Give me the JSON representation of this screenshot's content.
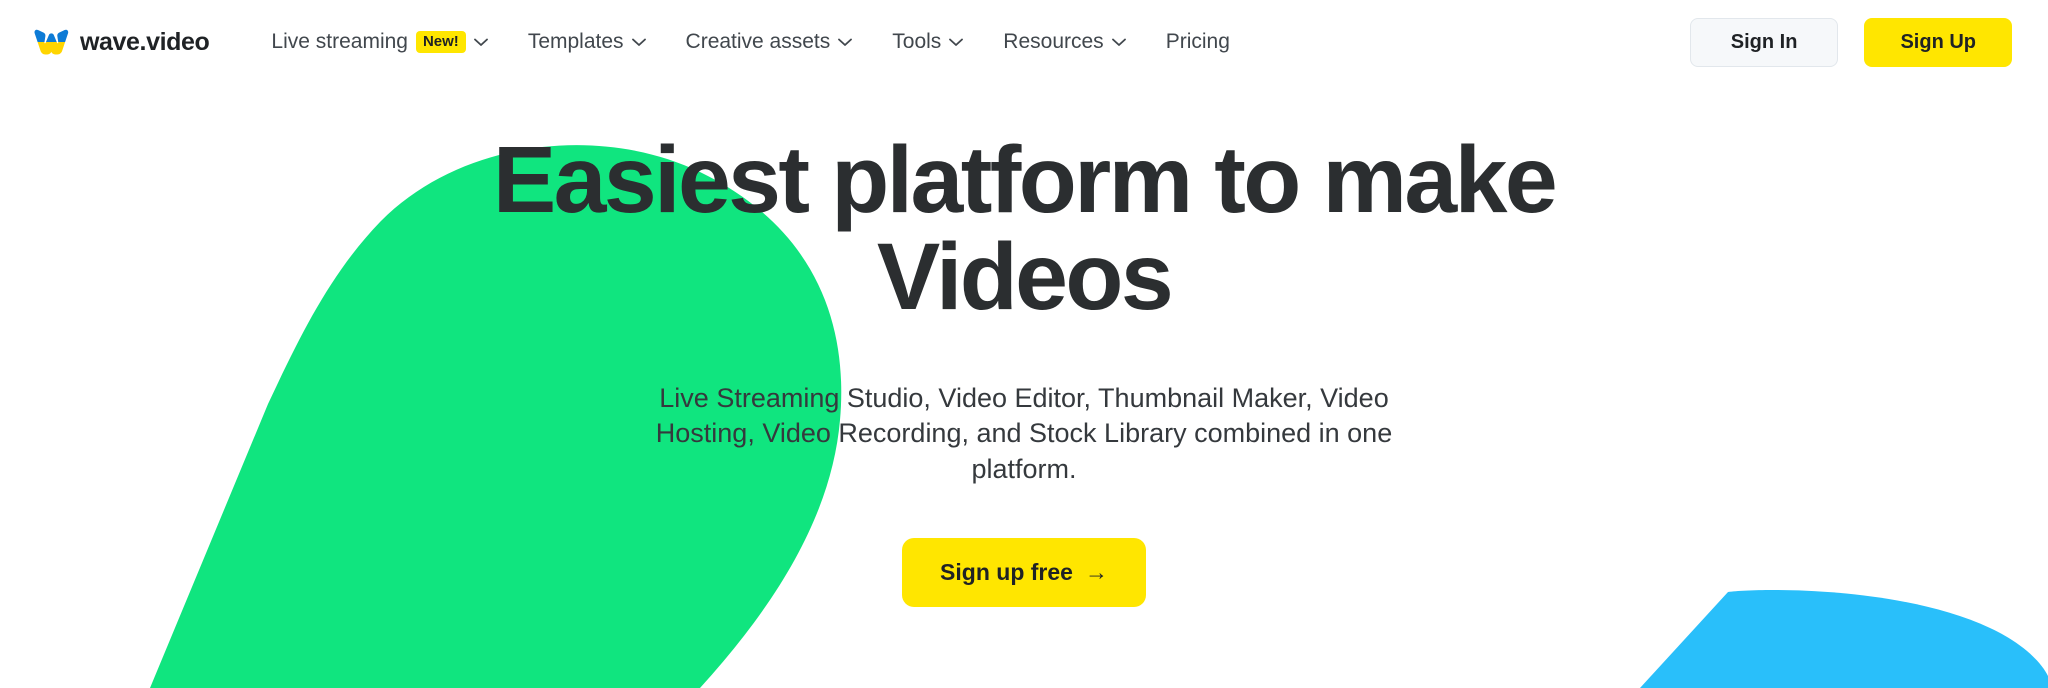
{
  "brand": {
    "name": "wave.video",
    "logo_icon": "wave-w-logo-icon",
    "logo_color_top": "#0d7bd6",
    "logo_color_bottom": "#ffd500"
  },
  "nav": {
    "items": [
      {
        "label": "Live streaming",
        "badge": "New!",
        "has_dropdown": true
      },
      {
        "label": "Templates",
        "badge": null,
        "has_dropdown": true
      },
      {
        "label": "Creative assets",
        "badge": null,
        "has_dropdown": true
      },
      {
        "label": "Tools",
        "badge": null,
        "has_dropdown": true
      },
      {
        "label": "Resources",
        "badge": null,
        "has_dropdown": true
      },
      {
        "label": "Pricing",
        "badge": null,
        "has_dropdown": false
      }
    ]
  },
  "auth": {
    "sign_in_label": "Sign In",
    "sign_up_label": "Sign Up"
  },
  "hero": {
    "title_line1": "Easiest platform to make",
    "title_line2": "Videos",
    "subtitle": "Live Streaming Studio, Video Editor, Thumbnail Maker, Video Hosting, Video Recording, and Stock Library combined in one platform.",
    "cta_label": "Sign up free",
    "cta_arrow": "→"
  },
  "colors": {
    "accent_yellow": "#ffe600",
    "blob_green": "#10e57f",
    "blob_blue": "#29bffa",
    "text_dark": "#2b2e30",
    "text_nav": "#41474d",
    "signin_bg": "#f6f8fa",
    "signin_border": "#e2e7ec"
  }
}
